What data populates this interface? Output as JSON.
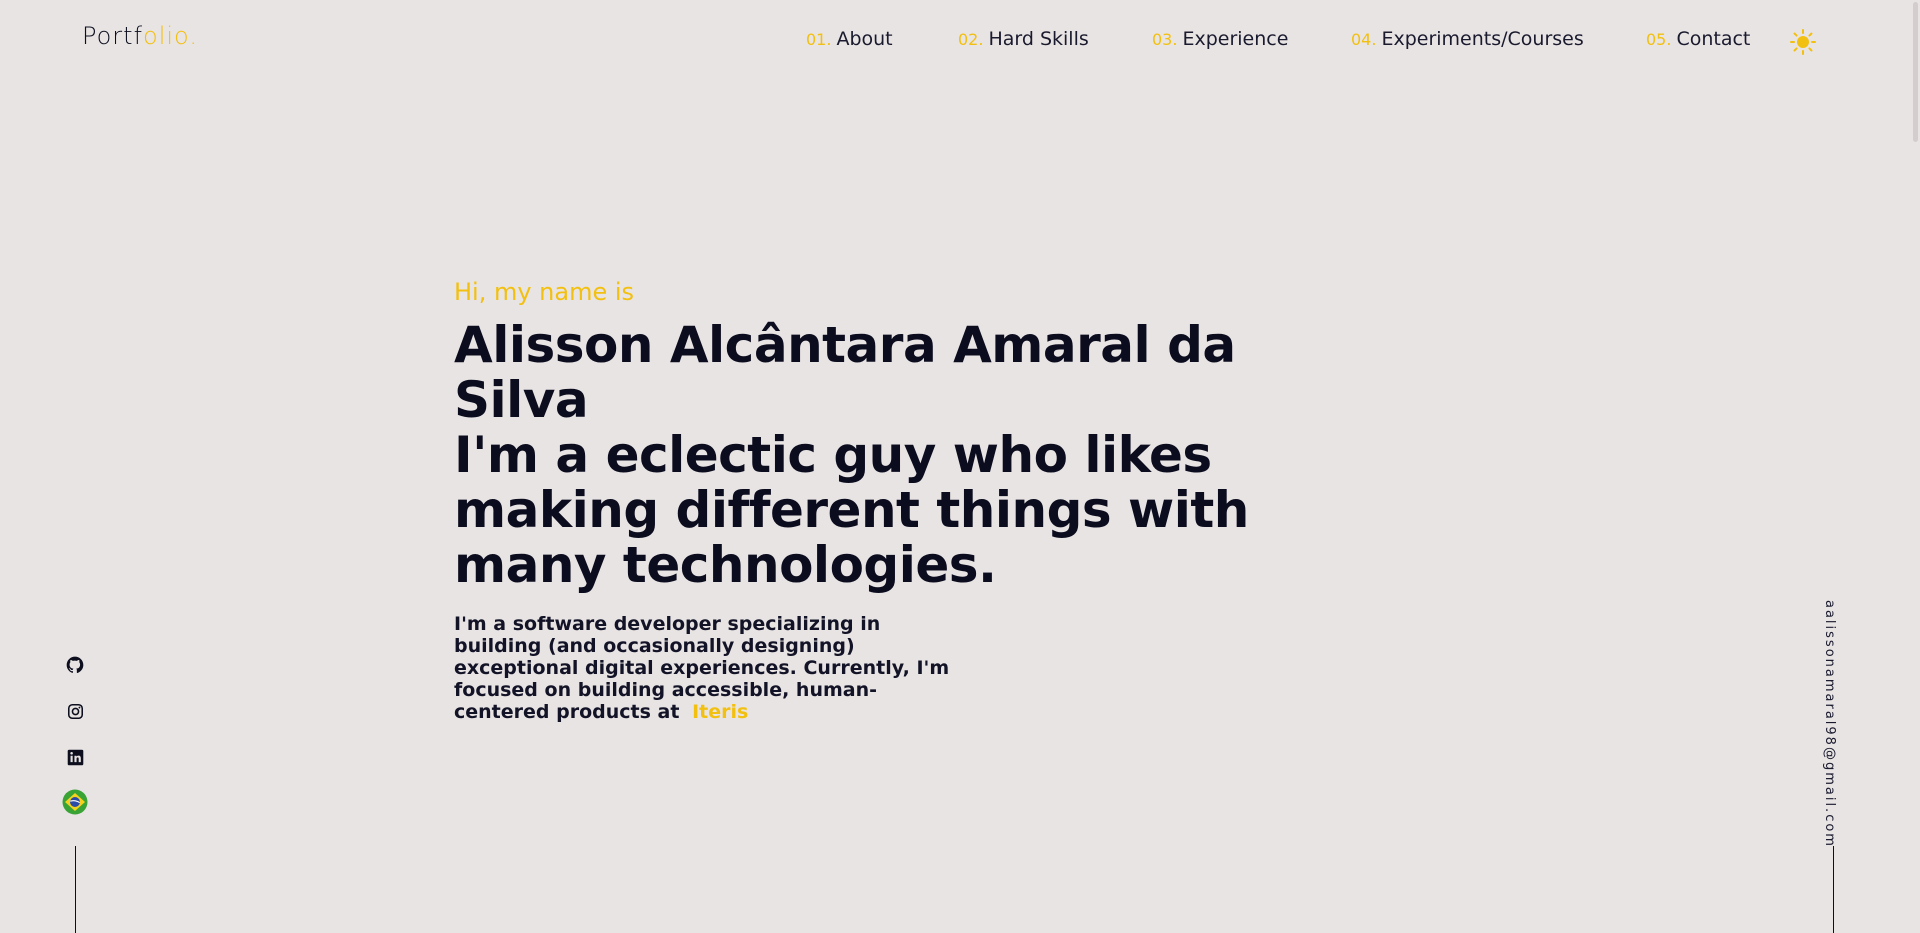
{
  "header": {
    "logo_main": "Portf",
    "logo_accent": "olio.",
    "nav": [
      {
        "num": "01.",
        "label": "About"
      },
      {
        "num": "02.",
        "label": "Hard Skills"
      },
      {
        "num": "03.",
        "label": "Experience"
      },
      {
        "num": "04.",
        "label": "Experiments/Courses"
      },
      {
        "num": "05.",
        "label": "Contact"
      }
    ],
    "theme_icon": "sun-icon"
  },
  "hero": {
    "greeting": "Hi, my name is",
    "name": "Alisson Alcântara Amaral da Silva",
    "tagline": "I'm a eclectic guy who likes making different things with many technologies.",
    "bio": "I'm a software developer specializing in building (and occasionally designing) exceptional digital experiences. Currently, I'm focused on building accessible, human-centered products at",
    "company": "Iteris"
  },
  "social": {
    "icons": [
      "github-icon",
      "instagram-icon",
      "linkedin-icon",
      "brazil-flag-icon"
    ]
  },
  "email": "aalissonamaral98@gmail.com",
  "colors": {
    "background": "#e9e4e4",
    "accent": "#f2c010",
    "text": "#0d0f1f"
  }
}
